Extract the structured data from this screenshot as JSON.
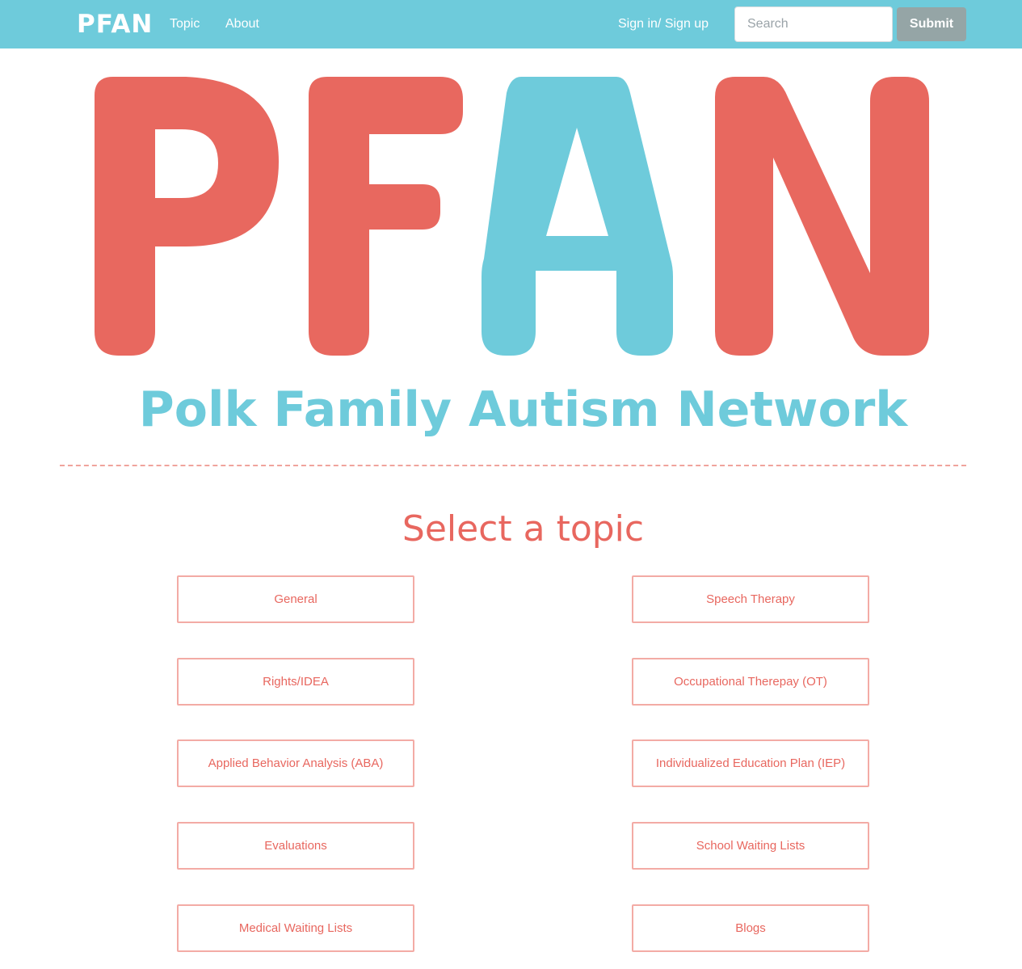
{
  "navbar": {
    "brand": "PFAN",
    "links": [
      "Topic",
      "About"
    ],
    "signin": "Sign in/ Sign up",
    "search_placeholder": "Search",
    "submit_label": "Submit",
    "background_color": "#6ecbdb"
  },
  "hero": {
    "logo_letters": [
      "P",
      "F",
      "A",
      "N"
    ],
    "logo_colors": [
      "#e8685f",
      "#e8685f",
      "#6ecbdb",
      "#e8685f"
    ],
    "tagline": "Polk Family Autism Network"
  },
  "topics": {
    "title": "Select a topic",
    "accent_color": "#e8675f",
    "items": [
      "General",
      "Speech Therapy",
      "Rights/IDEA",
      "Occupational Therepay (OT)",
      "Applied Behavior Analysis (ABA)",
      "Individualized Education Plan (IEP)",
      "Evaluations",
      "School Waiting Lists",
      "Medical Waiting Lists",
      "Blogs"
    ]
  }
}
